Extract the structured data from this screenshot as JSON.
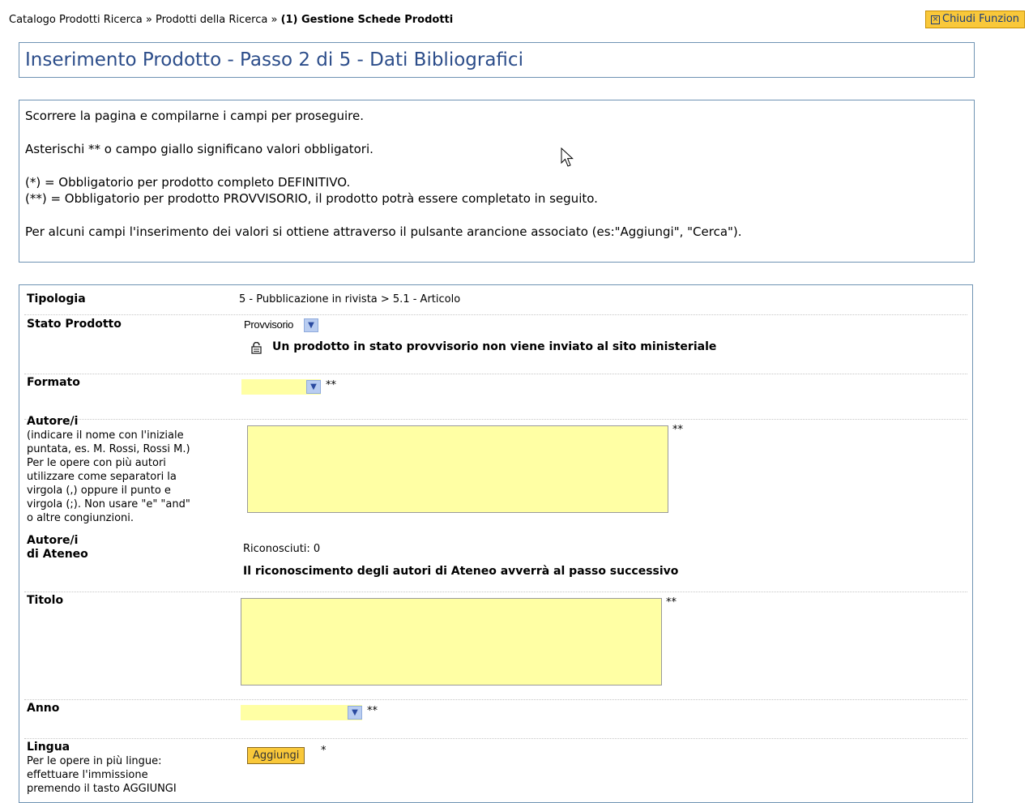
{
  "breadcrumb": {
    "item1": "Catalogo Prodotti Ricerca",
    "sep": "»",
    "item2": "Prodotti della Ricerca",
    "current": "(1) Gestione Schede Prodotti"
  },
  "close_button": {
    "label": "Chiudi Funzion"
  },
  "page_title": "Inserimento Prodotto - Passo 2 di 5 - Dati Bibliografici",
  "info": {
    "line1": "Scorrere la pagina e compilarne i campi per proseguire.",
    "line2": "Asterischi ** o campo giallo significano valori obbligatori.",
    "line3": "(*) = Obbligatorio per prodotto completo DEFINITIVO.",
    "line4": "(**) = Obbligatorio per prodotto PROVVISORIO, il prodotto potrà essere completato in seguito.",
    "line5": "Per alcuni campi l'inserimento dei valori si ottiene attraverso il pulsante arancione associato (es:\"Aggiungi\", \"Cerca\")."
  },
  "form": {
    "tipologia": {
      "label": "Tipologia",
      "value": "5 - Pubblicazione in rivista > 5.1 - Articolo"
    },
    "stato": {
      "label": "Stato Prodotto",
      "selected": "Provvisorio",
      "notice": "Un prodotto in stato provvisorio non viene inviato al sito ministeriale"
    },
    "formato": {
      "label": "Formato",
      "selected": "",
      "required": "**"
    },
    "autori": {
      "label": "Autore/i",
      "help1": "(indicare il nome con l'iniziale",
      "help2": "puntata, es. M. Rossi, Rossi M.)",
      "help3": "Per le opere con più autori",
      "help4": "utilizzare come separatori la",
      "help5": "virgola (,) oppure il punto e",
      "help6": "virgola (;). Non usare \"e\" \"and\"",
      "help7": "o altre congiunzioni.",
      "value": "",
      "required": "**"
    },
    "autori_ateneo": {
      "label1": "Autore/i",
      "label2": "di Ateneo",
      "riconosciuti": "Riconosciuti: 0",
      "notice": "Il riconoscimento degli autori di Ateneo avverrà al passo successivo"
    },
    "titolo": {
      "label": "Titolo",
      "value": "",
      "required": "**"
    },
    "anno": {
      "label": "Anno",
      "selected": "",
      "required": "**"
    },
    "lingua": {
      "label": "Lingua",
      "help1": "Per le opere in più lingue:",
      "help2": "effettuare l'immissione",
      "help3": "premendo il tasto AGGIUNGI",
      "button": "Aggiungi",
      "required": "*"
    }
  },
  "colors": {
    "accent": "#2c4d8a",
    "border": "#6f93b3",
    "required_field": "#ffffa4",
    "button": "#f9c83a"
  },
  "icons": {
    "lock": "lock-icon",
    "cursor": "mouse-cursor-icon",
    "close": "close-icon",
    "dropdown": "chevron-down-icon"
  }
}
